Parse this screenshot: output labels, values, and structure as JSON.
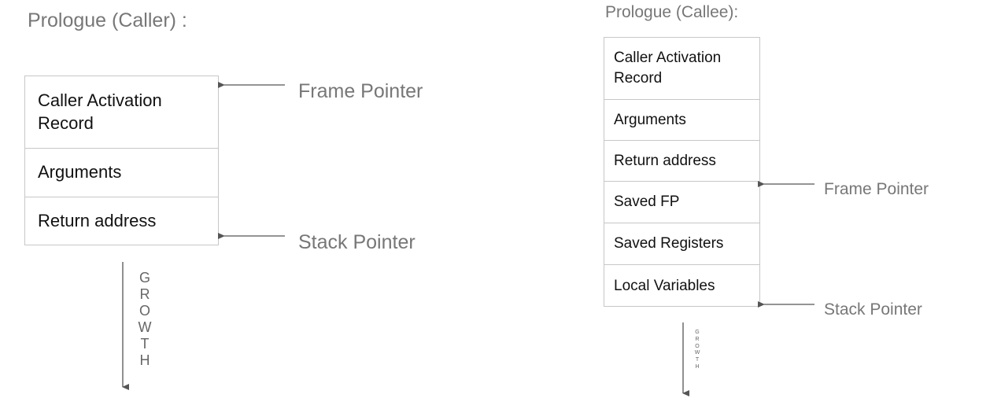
{
  "caller": {
    "title": "Prologue (Caller) :",
    "cells": [
      "Caller Activation Record",
      "Arguments",
      "Return address"
    ],
    "frame_pointer_label": "Frame Pointer",
    "stack_pointer_label": "Stack Pointer",
    "growth_letters": [
      "G",
      "R",
      "O",
      "W",
      "T",
      "H"
    ]
  },
  "callee": {
    "title": "Prologue (Callee):",
    "cells": [
      "Caller Activation Record",
      "Arguments",
      "Return address",
      "Saved FP",
      "Saved Registers",
      "Local Variables"
    ],
    "frame_pointer_label": "Frame Pointer",
    "stack_pointer_label": "Stack Pointer",
    "growth_letters": [
      "G",
      "R",
      "O",
      "W",
      "T",
      "H"
    ]
  },
  "colors": {
    "text": "#111111",
    "label": "#777777",
    "border": "#c7c7c7",
    "arrow": "#555555"
  }
}
